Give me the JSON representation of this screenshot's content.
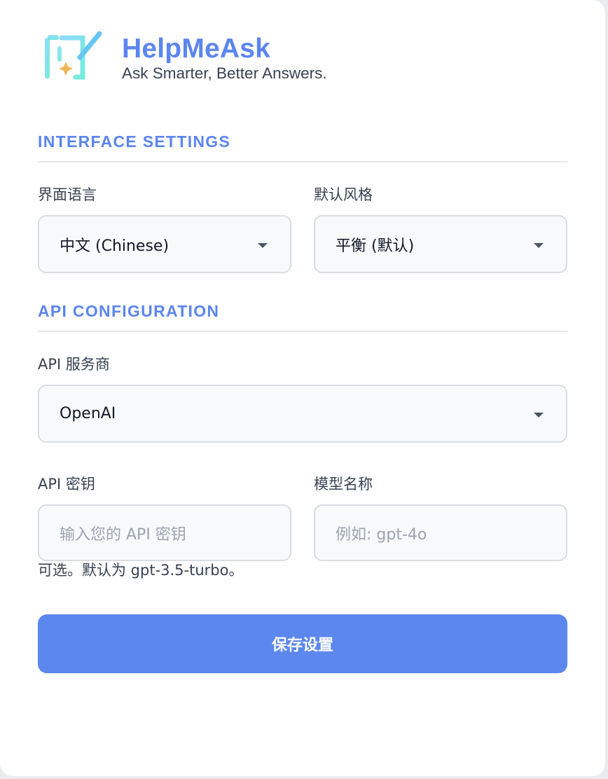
{
  "brand": {
    "name": "HelpMeAsk",
    "tagline": "Ask Smarter, Better Answers."
  },
  "interface_settings": {
    "title": "INTERFACE SETTINGS",
    "language": {
      "label": "界面语言",
      "value": "中文 (Chinese)"
    },
    "style": {
      "label": "默认风格",
      "value": "平衡 (默认)"
    }
  },
  "api_configuration": {
    "title": "API CONFIGURATION",
    "provider": {
      "label": "API 服务商",
      "value": "OpenAI"
    },
    "api_key": {
      "label": "API 密钥",
      "placeholder": "输入您的 API 密钥"
    },
    "model": {
      "label": "模型名称",
      "placeholder": "例如: gpt-4o",
      "helper": "可选。默认为 gpt-3.5-turbo。"
    }
  },
  "save_button": {
    "label": "保存设置"
  },
  "colors": {
    "accent": "#5b85ef",
    "button": "#5b87ee",
    "field_bg": "#f8f9fb",
    "field_border": "#d9dce1"
  },
  "icons": {
    "logo": "logo-icon",
    "dropdown": "chevron-down-icon"
  }
}
